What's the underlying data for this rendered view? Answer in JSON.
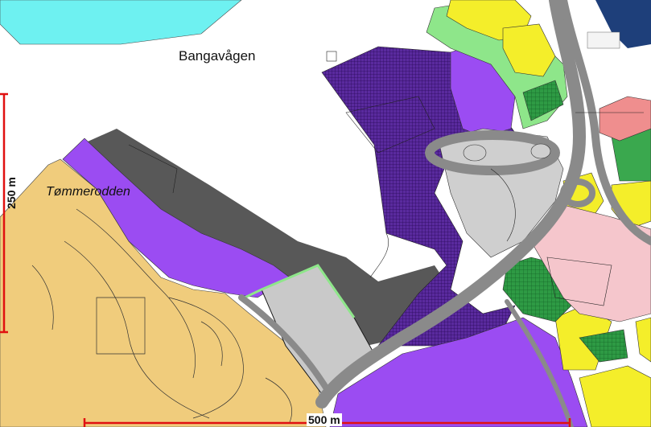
{
  "map": {
    "labels": {
      "bay": "Bangavågen",
      "peninsula": "Tømmerodden"
    },
    "scalebars": {
      "vertical": "250 m",
      "horizontal": "500 m"
    },
    "colors": {
      "water": "#6ef1f1",
      "residential_yellow": "#f4ee2a",
      "industry_purple": "#9b4cf2",
      "dark_purple_hatched": "#4b1b8f",
      "green_area": "#8ee68a",
      "dark_green": "#1f8a3a",
      "light_pink": "#f5c6cc",
      "salmon": "#ef8e8e",
      "sand": "#f0cc7c",
      "road_gray": "#8a8a8a",
      "dark_gray": "#585858",
      "light_gray": "#cfcfcf",
      "scalebar_red": "#e01010"
    }
  }
}
